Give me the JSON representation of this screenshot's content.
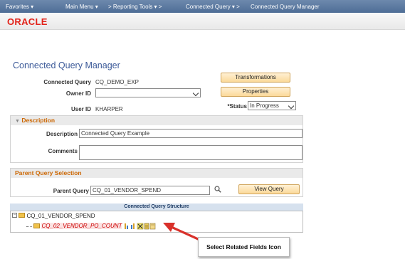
{
  "topnav": {
    "favorites": "Favorites ▾",
    "main_menu": "Main Menu ▾",
    "reporting_tools": "> Reporting Tools ▾ >",
    "connected_query": "Connected Query ▾ >",
    "manager": "Connected Query Manager"
  },
  "brand": {
    "logo": "ORACLE"
  },
  "page": {
    "title": "Connected Query Manager"
  },
  "form": {
    "connected_query_label": "Connected Query",
    "connected_query_value": "CQ_DEMO_EXP",
    "owner_id_label": "Owner ID",
    "owner_id_value": "",
    "user_id_label": "User ID",
    "user_id_value": "KHARPER",
    "status_label": "*Status",
    "status_value": "In Progress",
    "transformations_button": "Transformations",
    "properties_button": "Properties"
  },
  "description_section": {
    "header": "Description",
    "description_label": "Description",
    "description_value": "Connected Query Example",
    "comments_label": "Comments",
    "comments_value": ""
  },
  "parent_section": {
    "header": "Parent Query Selection",
    "parent_query_label": "Parent Query",
    "parent_query_value": "CQ_01_VENDOR_SPEND",
    "view_query_button": "View Query"
  },
  "structure": {
    "header": "Connected Query Structure",
    "root": "CQ_01_VENDOR_SPEND",
    "child": "CQ_02_VENDOR_PO_COUNT"
  },
  "callout": {
    "text": "Select Related Fields Icon"
  },
  "icons": {
    "expand": "collapse-icon",
    "folder": "folder-icon",
    "related_fields": "related-fields-icon",
    "add_child": "add-child-icon",
    "delete": "delete-icon",
    "document": "document-icon",
    "lookup": "magnifier-icon"
  },
  "colors": {
    "nav_bar": "#5b78a0",
    "oracle_red": "#e2231a",
    "section_header_text": "#cc6600",
    "title_blue": "#3b5998",
    "child_query_text": "#cc0000",
    "arrow_red": "#d9312b"
  }
}
